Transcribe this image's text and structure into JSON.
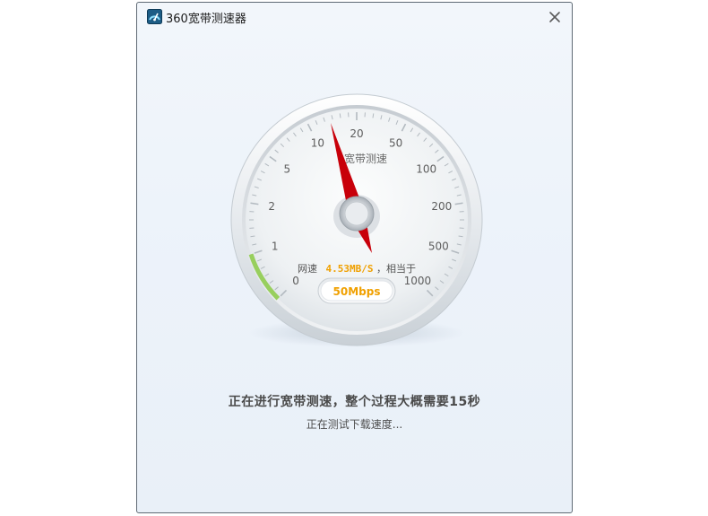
{
  "window": {
    "title": "360宽带测速器",
    "close_symbol": "✕"
  },
  "gauge": {
    "title": "宽带测速",
    "scale_labels": [
      "0",
      "1",
      "2",
      "5",
      "10",
      "20",
      "50",
      "100",
      "200",
      "500",
      "1000"
    ],
    "speed_prefix": "网速",
    "speed_value": "4.53MB/S",
    "speed_suffix": "，相当于",
    "equivalent": "50Mbps",
    "accent_color": "#f0a000",
    "needle_color": "#c8000a"
  },
  "status": {
    "main": "正在进行宽带测速，整个过程大概需要15秒",
    "sub": "正在测试下载速度..."
  },
  "icons": {
    "app": "speedometer-icon",
    "close": "close-icon"
  }
}
